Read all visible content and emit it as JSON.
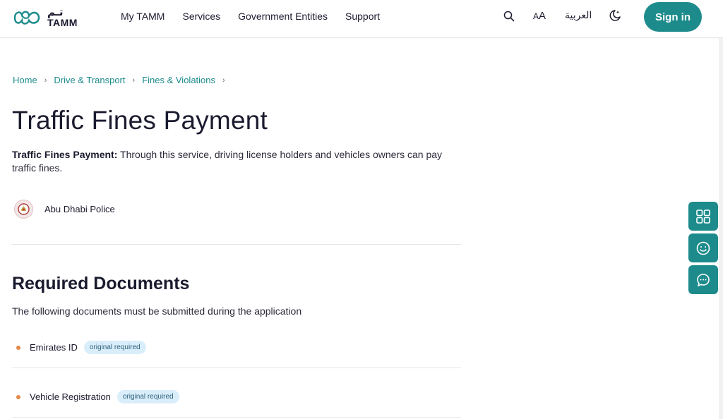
{
  "header": {
    "logo_ar": "تـم",
    "logo_en": "TAMM",
    "nav": [
      "My TAMM",
      "Services",
      "Government Entities",
      "Support"
    ],
    "font_size_label_big": "A",
    "font_size_label_small": "A",
    "language": "العربية",
    "signin_label": "Sign in",
    "accent": "#1d8b8c"
  },
  "breadcrumb": [
    "Home",
    "Drive & Transport",
    "Fines & Violations"
  ],
  "page": {
    "title": "Traffic Fines Payment",
    "desc_bold": "Traffic Fines Payment:",
    "desc_text": " Through this service, driving license holders and vehicles owners can pay traffic fines.",
    "entity": "Abu Dhabi Police"
  },
  "documents": {
    "title": "Required Documents",
    "subtitle": "The following documents must be submitted during the application",
    "items": [
      {
        "name": "Emirates ID",
        "badge": "original required"
      },
      {
        "name": "Vehicle Registration",
        "badge": "original required"
      }
    ]
  },
  "floating": [
    "grid-icon",
    "smiley-icon",
    "chat-icon"
  ]
}
